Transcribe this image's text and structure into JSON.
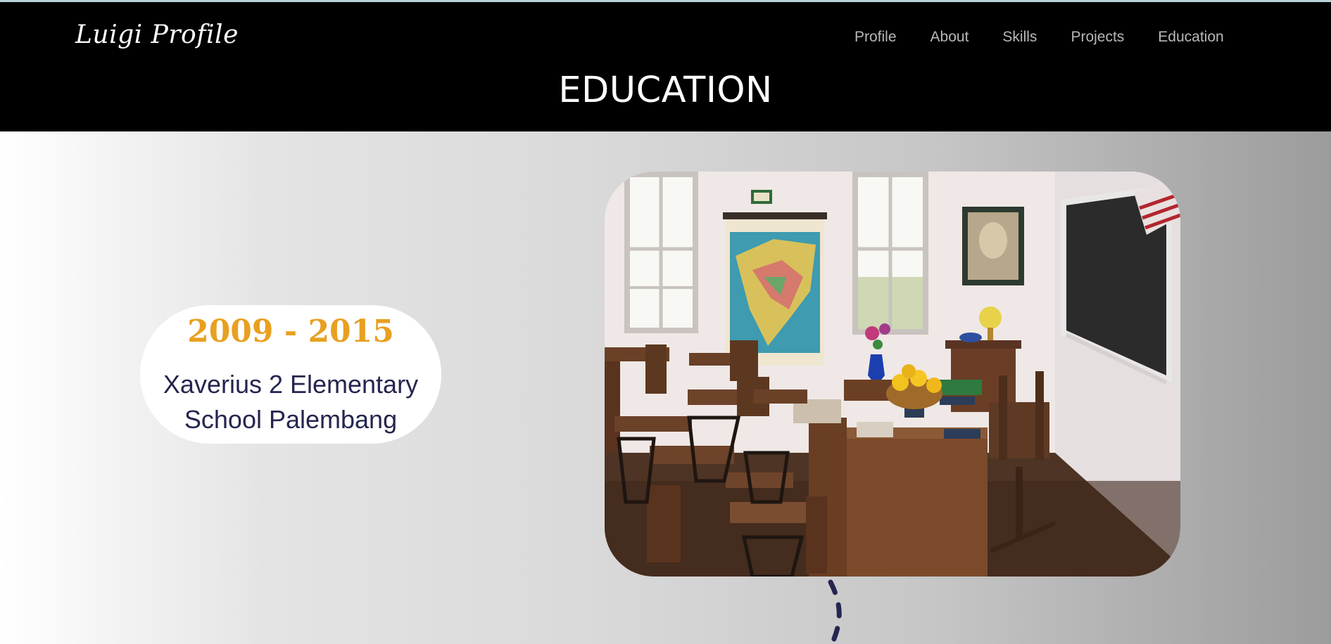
{
  "brand": {
    "logo_text": "Luigi Profile"
  },
  "nav": {
    "items": [
      {
        "label": "Profile"
      },
      {
        "label": "About"
      },
      {
        "label": "Skills"
      },
      {
        "label": "Projects"
      },
      {
        "label": "Education"
      }
    ]
  },
  "section": {
    "title": "EDUCATION"
  },
  "education": {
    "entries": [
      {
        "years": "2009 - 2015",
        "school": "Xaverius 2 Elementary School Palembang"
      }
    ]
  },
  "colors": {
    "header_bg": "#000000",
    "years_accent": "#e8a020",
    "school_text": "#24264f",
    "nav_text": "#b8b8b8"
  }
}
